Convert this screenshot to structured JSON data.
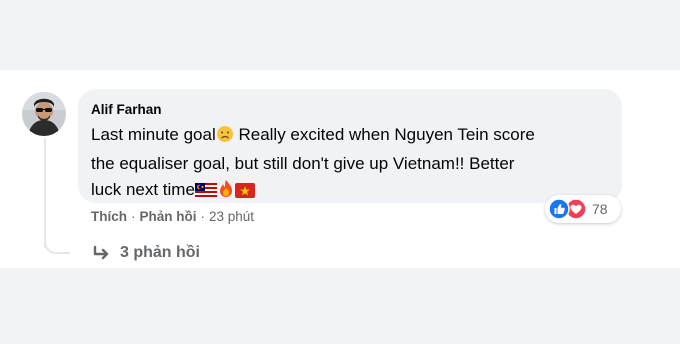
{
  "comment": {
    "author": "Alif Farhan",
    "line1_a": "Last minute goal",
    "line1_b": " Really excited when Nguyen Tein score",
    "line2": "the equaliser goal, but still don't give up Vietnam!! Better",
    "line3": "luck next time",
    "emojis": [
      "sad-face-emoji",
      "malaysia-flag-emoji",
      "fire-emoji",
      "vietnam-flag-emoji"
    ]
  },
  "actions": {
    "like_label": "Thích",
    "reply_label": "Phản hồi",
    "time": "23 phút",
    "separator": "·"
  },
  "reactions": {
    "types": [
      "like-icon",
      "love-icon"
    ],
    "count": "78"
  },
  "replies": {
    "label": "3 phản hồi",
    "icon": "reply-arrow-icon"
  },
  "colors": {
    "page_bg": "#f2f3f5",
    "bubble_bg": "#f0f2f5",
    "meta_text": "#65676b",
    "like_blue": "#1877f2",
    "love_red": "#f33e58"
  }
}
